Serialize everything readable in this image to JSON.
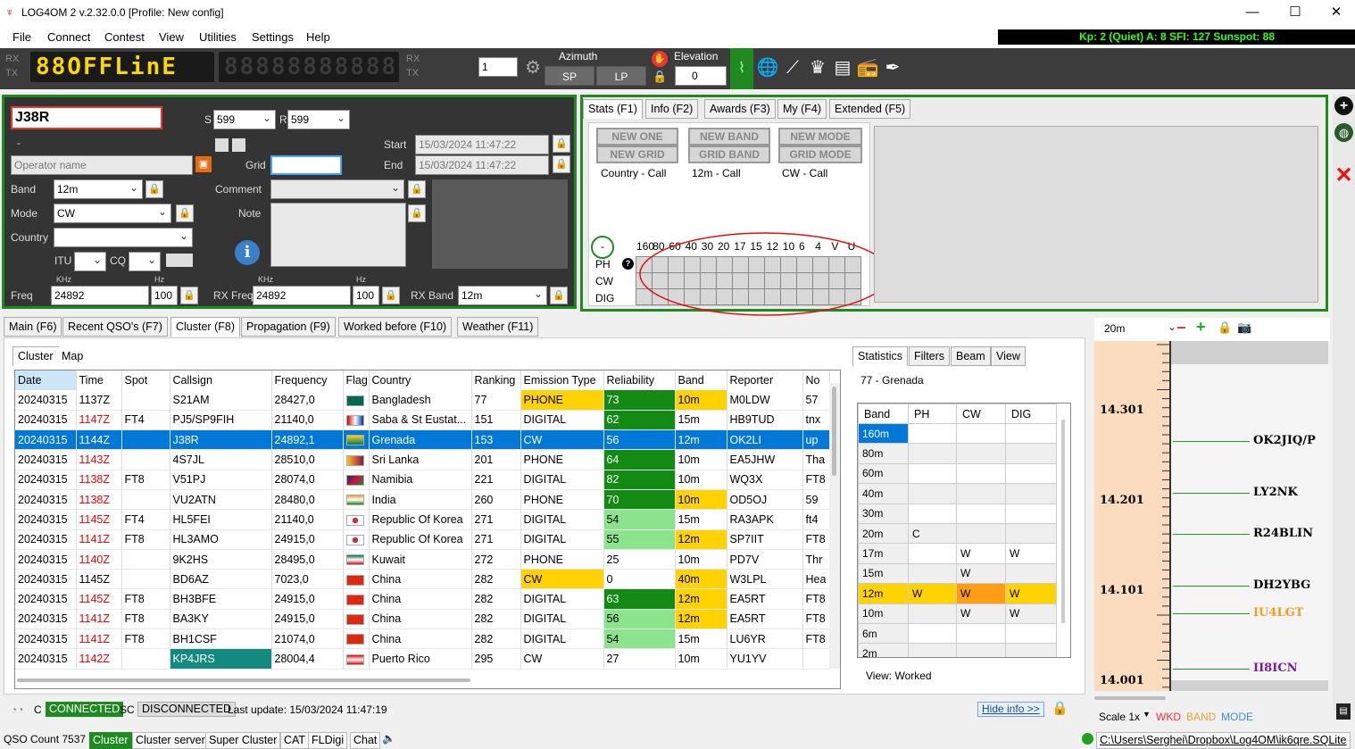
{
  "window": {
    "title": "LOG4OM 2 v.2.32.0.0 [Profile: New config]",
    "min": "—",
    "max": "☐",
    "close": "✕"
  },
  "menu": [
    "File",
    "Connect",
    "Contest",
    "View",
    "Utilities",
    "Settings",
    "Help"
  ],
  "solar": "Kp: 2 (Quiet)  A: 8  SFI: 127 Sunspot: 88",
  "toolbar": {
    "rx": "RX",
    "tx": "TX",
    "display1": "88OFFLinE",
    "display2": "88888888888",
    "rx2": "RX",
    "tx2": "TX",
    "spin": "1",
    "azimuth": "Azimuth",
    "sp": "SP",
    "lp": "LP",
    "elevation": "Elevation",
    "elev_val": "0"
  },
  "qso": {
    "call": "J38R",
    "dash": "-",
    "s_label": "S",
    "s_val": "599",
    "r_label": "R",
    "r_val": "599",
    "operator_ph": "Operator name",
    "grid_label": "Grid",
    "start_label": "Start",
    "start_val": "15/03/2024 11:47:22",
    "end_label": "End",
    "end_val": "15/03/2024 11:47:22",
    "band_label": "Band",
    "band_val": "12m",
    "comment_label": "Comment",
    "mode_label": "Mode",
    "mode_val": "CW",
    "note_label": "Note",
    "country_label": "Country",
    "itu": "ITU",
    "cq": "CQ",
    "freq_label": "Freq",
    "khz": "KHz",
    "hz": "Hz",
    "freq_val": "24892",
    "freq_hz": "100",
    "rxfreq_label": "RX Freq",
    "rxfreq_val": "24892",
    "rxfreq_hz": "100",
    "rxband_label": "RX Band",
    "rxband_val": "12m"
  },
  "stats": {
    "tabs": [
      "Stats (F1)",
      "Info (F2)",
      "Awards (F3)",
      "My (F4)",
      "Extended (F5)"
    ],
    "buttons": [
      [
        "NEW ONE",
        "NEW BAND",
        "NEW MODE"
      ],
      [
        "NEW GRID",
        "GRID BAND",
        "GRID MODE"
      ]
    ],
    "captions": [
      "Country - Call",
      "12m - Call",
      "CW - Call"
    ],
    "bands": [
      "160",
      "80",
      "60",
      "40",
      "30",
      "20",
      "17",
      "15",
      "12",
      "10",
      "6",
      "4",
      "V",
      "U"
    ],
    "modes": [
      "PH",
      "CW",
      "DIG"
    ],
    "minus": "-",
    "help": "?"
  },
  "bottom_tabs": [
    "Main (F6)",
    "Recent QSO's (F7)",
    "Cluster (F8)",
    "Propagation (F9)",
    "Worked before (F10)",
    "Weather (F11)"
  ],
  "cluster_tabs": [
    "Cluster",
    "Map"
  ],
  "cluster": {
    "headers": [
      "Date",
      "Time",
      "Spot",
      "Callsign",
      "Frequency",
      "Flag",
      "Country",
      "Ranking",
      "Emission Type",
      "Reliability",
      "Band",
      "Reporter",
      "No"
    ],
    "rows": [
      [
        "20240315",
        "1137Z",
        "",
        "S21AM",
        "28427,0",
        "",
        "Bangladesh",
        "77",
        "PHONE",
        "73",
        "10m",
        "M0LDW",
        "57"
      ],
      [
        "20240315",
        "1147Z",
        "FT4",
        "PJ5/SP9FIH",
        "21140,0",
        "",
        "Saba & St Eustat...",
        "151",
        "DIGITAL",
        "62",
        "15m",
        "HB9TUD",
        "tnx"
      ],
      [
        "20240315",
        "1144Z",
        "",
        "J38R",
        "24892,1",
        "",
        "Grenada",
        "153",
        "CW",
        "56",
        "12m",
        "OK2LI",
        "up"
      ],
      [
        "20240315",
        "1143Z",
        "",
        "4S7JL",
        "28510,0",
        "",
        "Sri Lanka",
        "201",
        "PHONE",
        "64",
        "10m",
        "EA5JHW",
        "Tha"
      ],
      [
        "20240315",
        "1138Z",
        "FT8",
        "V51PJ",
        "28074,0",
        "",
        "Namibia",
        "221",
        "DIGITAL",
        "82",
        "10m",
        "WQ3X",
        "FT8"
      ],
      [
        "20240315",
        "1138Z",
        "",
        "VU2ATN",
        "28480,0",
        "",
        "India",
        "260",
        "PHONE",
        "70",
        "10m",
        "OD5OJ",
        "59"
      ],
      [
        "20240315",
        "1145Z",
        "FT4",
        "HL5FEI",
        "21140,0",
        "",
        "Republic Of Korea",
        "271",
        "DIGITAL",
        "54",
        "15m",
        "RA3APK",
        "ft4"
      ],
      [
        "20240315",
        "1141Z",
        "FT8",
        "HL3AMO",
        "24915,0",
        "",
        "Republic Of Korea",
        "271",
        "DIGITAL",
        "55",
        "12m",
        "SP7IIT",
        "FT8"
      ],
      [
        "20240315",
        "1140Z",
        "",
        "9K2HS",
        "28495,0",
        "",
        "Kuwait",
        "272",
        "PHONE",
        "25",
        "10m",
        "PD7V",
        "Thr"
      ],
      [
        "20240315",
        "1145Z",
        "",
        "BD6AZ",
        "7023,0",
        "",
        "China",
        "282",
        "CW",
        "0",
        "40m",
        "W3LPL",
        "Hea"
      ],
      [
        "20240315",
        "1145Z",
        "FT8",
        "BH3BFE",
        "24915,0",
        "",
        "China",
        "282",
        "DIGITAL",
        "63",
        "12m",
        "EA5RT",
        "FT8"
      ],
      [
        "20240315",
        "1141Z",
        "FT8",
        "BA3KY",
        "24915,0",
        "",
        "China",
        "282",
        "DIGITAL",
        "56",
        "12m",
        "EA5RT",
        "FT8"
      ],
      [
        "20240315",
        "1141Z",
        "FT8",
        "BH1CSF",
        "21074,0",
        "",
        "China",
        "282",
        "DIGITAL",
        "54",
        "15m",
        "LU6YR",
        "FT8"
      ],
      [
        "20240315",
        "1142Z",
        "",
        "KP4JRS",
        "28004,4",
        "",
        "Puerto Rico",
        "295",
        "CW",
        "27",
        "10m",
        "YU1YV",
        ""
      ]
    ]
  },
  "side_tabs": [
    "Statistics",
    "Filters",
    "Beam",
    "View"
  ],
  "side_country": "77 - Grenada",
  "band_stats": {
    "headers": [
      "Band",
      "PH",
      "CW",
      "DIG"
    ],
    "rows": [
      [
        "160m",
        "",
        "",
        ""
      ],
      [
        "80m",
        "",
        "",
        ""
      ],
      [
        "60m",
        "",
        "",
        ""
      ],
      [
        "40m",
        "",
        "",
        ""
      ],
      [
        "30m",
        "",
        "",
        ""
      ],
      [
        "20m",
        "C",
        "",
        ""
      ],
      [
        "17m",
        "",
        "W",
        "W"
      ],
      [
        "15m",
        "",
        "W",
        ""
      ],
      [
        "12m",
        "W",
        "W",
        "W"
      ],
      [
        "10m",
        "",
        "W",
        "W"
      ],
      [
        "6m",
        "",
        "",
        ""
      ],
      [
        "2m",
        "",
        "",
        ""
      ]
    ],
    "view": "View:  Worked"
  },
  "bandmap": {
    "band": "20m",
    "freqs": [
      "14.301",
      "14.201",
      "14.101",
      "14.001"
    ],
    "spots": [
      {
        "call": "OK2JIQ/P",
        "color": "#000000"
      },
      {
        "call": "LY2NK",
        "color": "#000000"
      },
      {
        "call": "R24BLIN",
        "color": "#000000"
      },
      {
        "call": "DH2YBG",
        "color": "#000000"
      },
      {
        "call": "IU4LGT",
        "color": "#f59a1c"
      },
      {
        "call": "II8ICN",
        "color": "#7a1aa0"
      }
    ],
    "scale": "Scale 1x",
    "wkd": "WKD",
    "band_lbl": "BAND",
    "mode_lbl": "MODE"
  },
  "footer": {
    "cc": "C",
    "connected": "CONNECTED",
    "sc": "SC",
    "disconnected": "DISCONNECTED",
    "last_update": "Last update:  15/03/2024 11:47:19",
    "hide_info": "Hide info >>"
  },
  "status": {
    "qso_count": "QSO Count  7537",
    "cluster": "Cluster",
    "cluster_server": "Cluster server",
    "super_cluster": "Super Cluster",
    "cat": "CAT",
    "fldigi": "FLDigi",
    "chat": "Chat",
    "db": "C:\\Users\\Serghei\\Dropbox\\Log4OM\\ik6qre.SQLite"
  }
}
